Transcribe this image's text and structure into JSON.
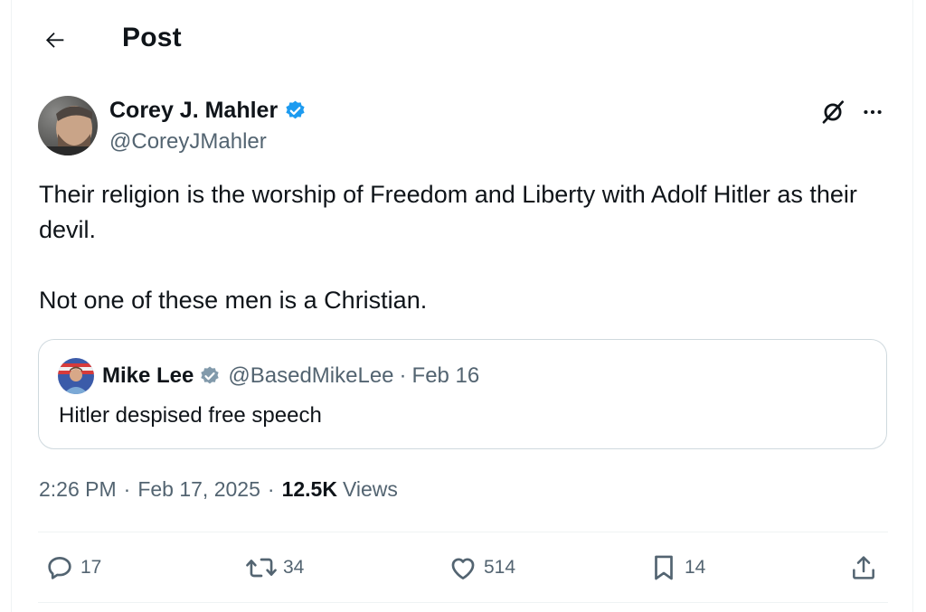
{
  "header": {
    "title": "Post",
    "back_icon": "arrow-left-icon"
  },
  "post": {
    "author": {
      "name": "Corey J. Mahler",
      "handle": "@CoreyJMahler",
      "verified": true
    },
    "text": [
      "Their religion is the worship of Freedom and Liberty with Adolf Hitler as their devil.",
      "Not one of these men is a Christian."
    ],
    "quoted": {
      "name": "Mike Lee",
      "handle": "@BasedMikeLee",
      "separator": "·",
      "date": "Feb 16",
      "verified": true,
      "text": "Hitler despised free speech"
    },
    "time": "2:26 PM",
    "date": "Feb 17, 2025",
    "separator": "·",
    "views_count": "12.5K",
    "views_label": "Views"
  },
  "actions": {
    "replies": "17",
    "reposts": "34",
    "likes": "514",
    "bookmarks": "14"
  },
  "colors": {
    "text_primary": "#0f1419",
    "text_secondary": "#536471",
    "verified_blue": "#1d9bf0",
    "verified_gray": "#829aab",
    "border": "#cfd9de",
    "divider": "#eff3f4"
  }
}
